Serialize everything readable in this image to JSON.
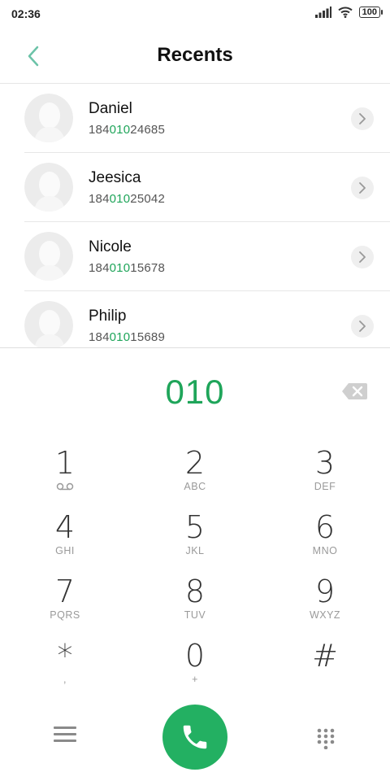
{
  "status_bar": {
    "time": "02:36",
    "battery": "100"
  },
  "header": {
    "title": "Recents"
  },
  "recents": [
    {
      "name": "Daniel",
      "number_prefix": "184",
      "number_match": "010",
      "number_suffix": "24685"
    },
    {
      "name": "Jeesica",
      "number_prefix": "184",
      "number_match": "010",
      "number_suffix": "25042"
    },
    {
      "name": "Nicole",
      "number_prefix": "184",
      "number_match": "010",
      "number_suffix": "15678"
    },
    {
      "name": "Philip",
      "number_prefix": "184",
      "number_match": "010",
      "number_suffix": "15689"
    }
  ],
  "dialer": {
    "entry": "010"
  },
  "keypad": [
    {
      "digit": "1",
      "letters": ""
    },
    {
      "digit": "2",
      "letters": "ABC"
    },
    {
      "digit": "3",
      "letters": "DEF"
    },
    {
      "digit": "4",
      "letters": "GHI"
    },
    {
      "digit": "5",
      "letters": "JKL"
    },
    {
      "digit": "6",
      "letters": "MNO"
    },
    {
      "digit": "7",
      "letters": "PQRS"
    },
    {
      "digit": "8",
      "letters": "TUV"
    },
    {
      "digit": "9",
      "letters": "WXYZ"
    },
    {
      "digit": "*",
      "letters": ","
    },
    {
      "digit": "0",
      "letters": "+"
    },
    {
      "digit": "#",
      "letters": ""
    }
  ],
  "colors": {
    "accent": "#23b062",
    "highlight": "#1fa55a",
    "back_arrow": "#6cc3a8"
  },
  "icons": {
    "back": "back-arrow-icon",
    "chevron": "chevron-right-icon",
    "backspace": "backspace-icon",
    "voicemail": "voicemail-icon",
    "menu": "menu-icon",
    "call": "phone-call-icon",
    "dialpad": "dialpad-icon"
  }
}
